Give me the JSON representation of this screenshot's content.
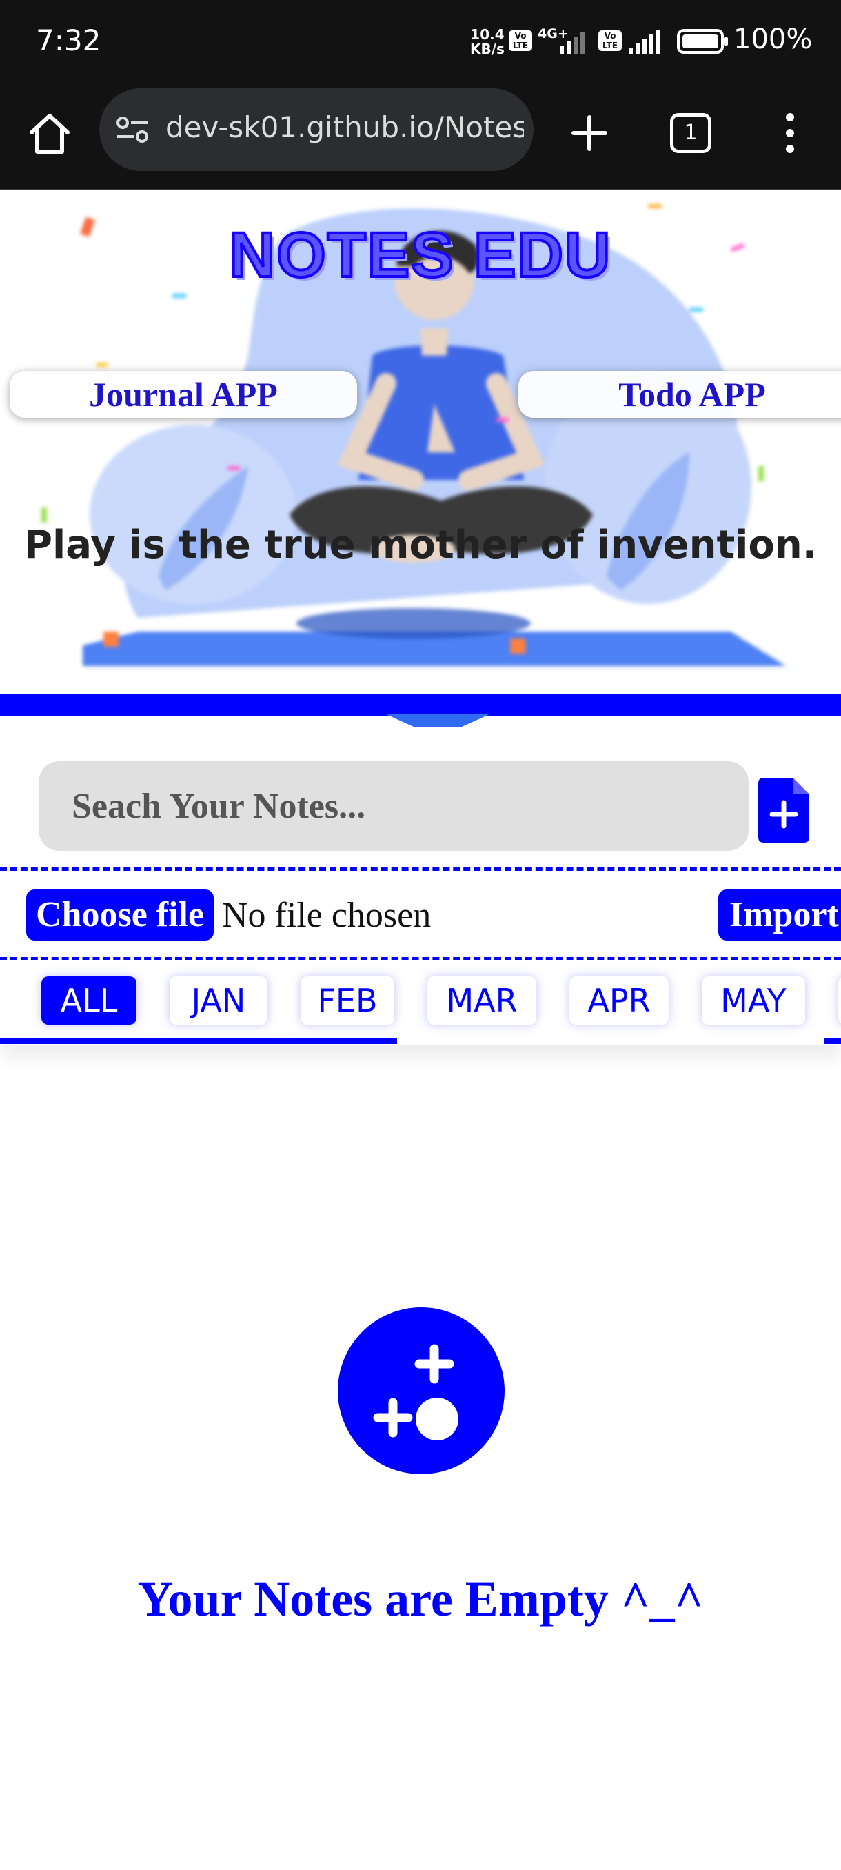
{
  "status_bar": {
    "time": "7:32",
    "speed_value": "10.4",
    "speed_unit": "KB/s",
    "volte_label": "Vo LTE",
    "network": "4G+",
    "battery": "100%"
  },
  "browser": {
    "url": "dev-sk01.github.io/Notes",
    "tab_count": "1"
  },
  "hero": {
    "title": "NOTES EDU",
    "journal_button": "Journal APP",
    "todo_button": "Todo APP",
    "quote": "Play is the true mother of invention."
  },
  "search": {
    "placeholder": "Seach Your Notes..."
  },
  "import_row": {
    "choose_file": "Choose file",
    "file_status": "No file chosen",
    "import": "Import"
  },
  "months": [
    {
      "label": "ALL",
      "active": true
    },
    {
      "label": "JAN",
      "active": false
    },
    {
      "label": "FEB",
      "active": false
    },
    {
      "label": "MAR",
      "active": false
    },
    {
      "label": "APR",
      "active": false
    },
    {
      "label": "MAY",
      "active": false
    }
  ],
  "empty_state": {
    "message": "Your Notes are Empty ^_^"
  },
  "colors": {
    "accent": "#0000ff",
    "status_bar_bg": "#121212",
    "url_pill_bg": "#2c2d31",
    "search_bg": "#e0e0e0"
  },
  "icons": {
    "home": "home-icon",
    "site_settings": "site-settings-icon",
    "new_tab": "plus-icon",
    "tabs": "tab-count-icon",
    "menu": "more-vertical-icon",
    "add_note": "file-plus-icon",
    "empty": "game-dice-icon"
  }
}
